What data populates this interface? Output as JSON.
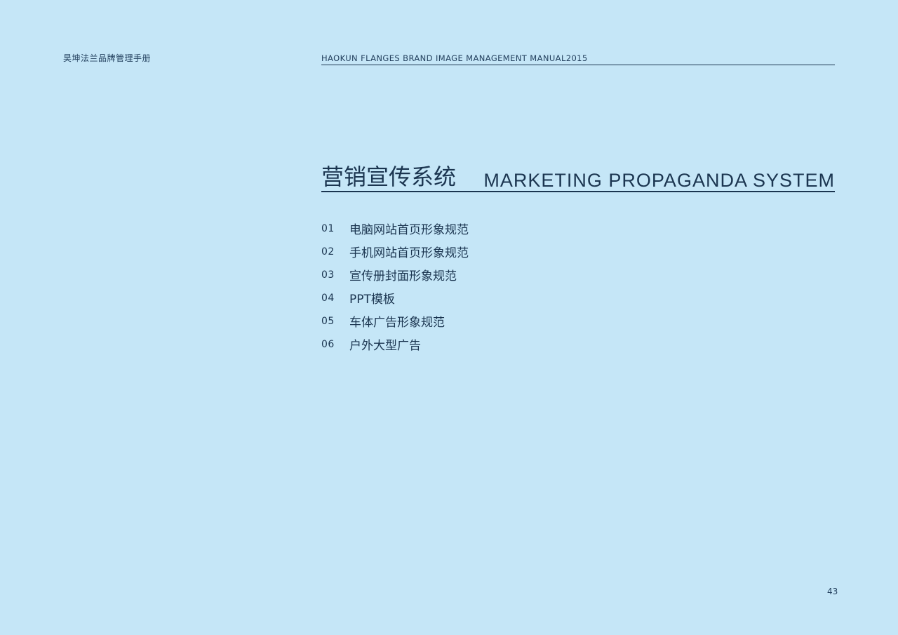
{
  "header": {
    "left_title": "昊坤法兰品牌管理手册",
    "right_title": "HAOKUN FLANGES BRAND IMAGE MANAGEMENT MANUAL2015"
  },
  "section": {
    "title_cn": "营销宣传系统",
    "title_en": "MARKETING PROPAGANDA SYSTEM"
  },
  "toc": [
    {
      "num": "01",
      "label": "电脑网站首页形象规范"
    },
    {
      "num": "02",
      "label": "手机网站首页形象规范"
    },
    {
      "num": "03",
      "label": "宣传册封面形象规范"
    },
    {
      "num": "04",
      "label": "PPT模板"
    },
    {
      "num": "05",
      "label": "车体广告形象规范"
    },
    {
      "num": "06",
      "label": "户外大型广告"
    }
  ],
  "page_number": "43",
  "colors": {
    "background": "#c5e6f7",
    "text": "#1b3550"
  }
}
